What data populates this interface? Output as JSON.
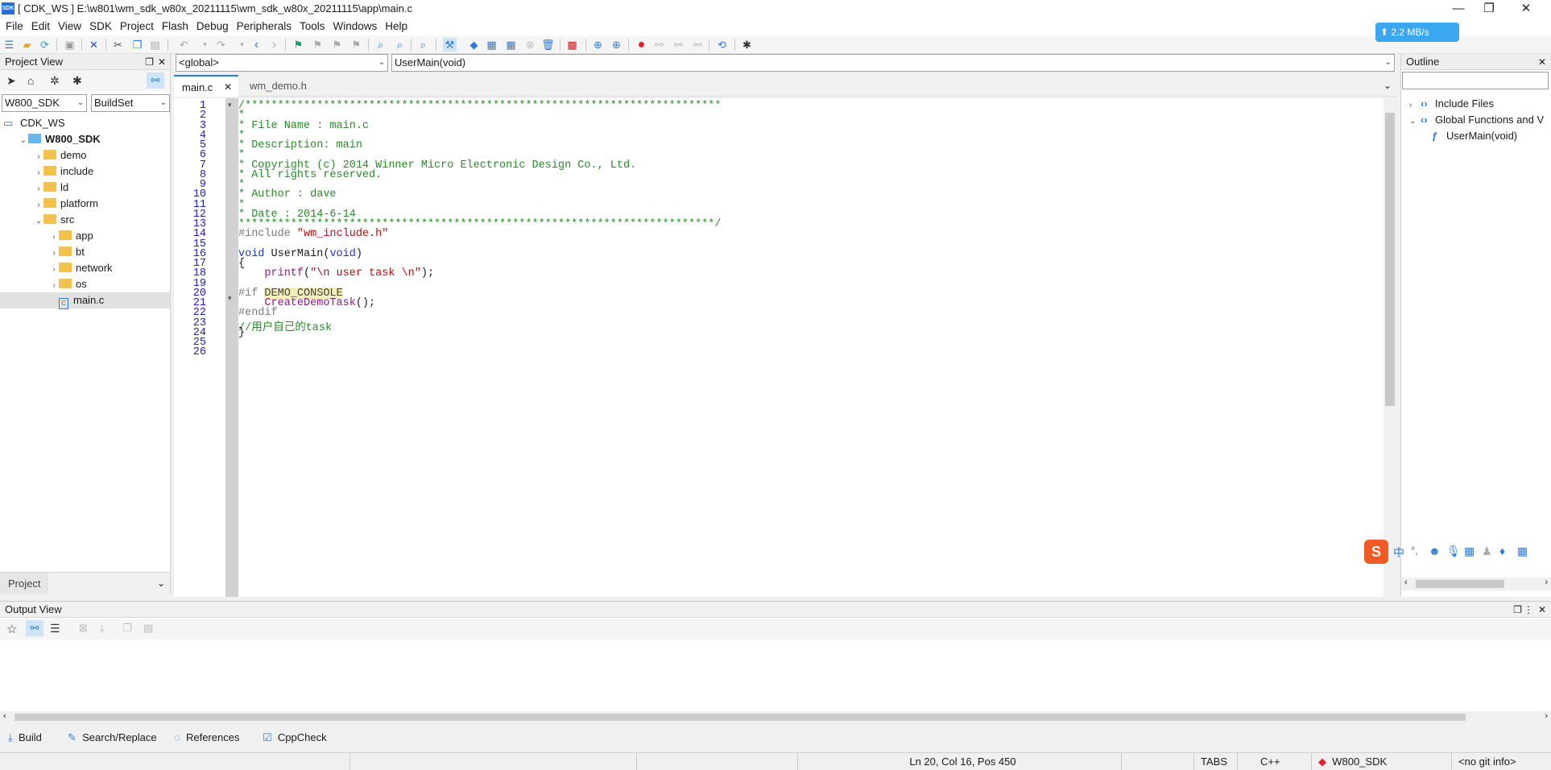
{
  "window": {
    "logo": "SDK",
    "title": "[ CDK_WS ] E:\\w801\\wm_sdk_w80x_20211115\\wm_sdk_w80x_20211115\\app\\main.c",
    "minimize": "—",
    "maximize": "❐",
    "close": "✕"
  },
  "menu": [
    "File",
    "Edit",
    "View",
    "SDK",
    "Project",
    "Flash",
    "Debug",
    "Peripherals",
    "Tools",
    "Windows",
    "Help"
  ],
  "network_speed": "⬆ 2.2 MB/s",
  "project_view": {
    "title": "Project View",
    "project_combo": "W800_SDK",
    "buildset_combo": "BuildSet",
    "tree": [
      {
        "label": "CDK_WS",
        "indent": 0,
        "kind": "workspace",
        "chev": ""
      },
      {
        "label": "W800_SDK",
        "indent": 1,
        "kind": "project",
        "chev": "⌄"
      },
      {
        "label": "demo",
        "indent": 2,
        "kind": "folder",
        "chev": "›"
      },
      {
        "label": "include",
        "indent": 2,
        "kind": "folder",
        "chev": "›"
      },
      {
        "label": "ld",
        "indent": 2,
        "kind": "folder",
        "chev": "›"
      },
      {
        "label": "platform",
        "indent": 2,
        "kind": "folder",
        "chev": "›"
      },
      {
        "label": "src",
        "indent": 2,
        "kind": "folder",
        "chev": "⌄"
      },
      {
        "label": "app",
        "indent": 3,
        "kind": "folder",
        "chev": "›"
      },
      {
        "label": "bt",
        "indent": 3,
        "kind": "folder",
        "chev": "›"
      },
      {
        "label": "network",
        "indent": 3,
        "kind": "folder",
        "chev": "›"
      },
      {
        "label": "os",
        "indent": 3,
        "kind": "folder",
        "chev": "›"
      },
      {
        "label": "main.c",
        "indent": 3,
        "kind": "file",
        "chev": "",
        "selected": true
      }
    ],
    "bottom_tab": "Project"
  },
  "editor": {
    "scope_combo": "<global>",
    "function_combo": "UserMain(void)",
    "tabs": [
      {
        "label": "main.c",
        "active": true,
        "close": "✕"
      },
      {
        "label": "wm_demo.h",
        "active": false
      }
    ],
    "lines": [
      {
        "n": "1",
        "t": "/*************************************************************************",
        "c": "comment"
      },
      {
        "n": "2",
        "t": "*",
        "c": "comment"
      },
      {
        "n": "3",
        "t": "* File Name : main.c",
        "c": "comment"
      },
      {
        "n": "4",
        "t": "*",
        "c": "comment"
      },
      {
        "n": "5",
        "t": "* Description: main",
        "c": "comment"
      },
      {
        "n": "6",
        "t": "*",
        "c": "comment"
      },
      {
        "n": "7",
        "t": "* Copyright (c) 2014 Winner Micro Electronic Design Co., Ltd.",
        "c": "comment"
      },
      {
        "n": "8",
        "t": "* All rights reserved.",
        "c": "comment"
      },
      {
        "n": "9",
        "t": "*",
        "c": "comment"
      },
      {
        "n": "10",
        "t": "* Author : dave",
        "c": "comment"
      },
      {
        "n": "11",
        "t": "*",
        "c": "comment"
      },
      {
        "n": "12",
        "t": "* Date : 2014-6-14",
        "c": "comment"
      },
      {
        "n": "13",
        "t": "*************************************************************************/",
        "c": "comment"
      },
      {
        "n": "14",
        "t": "",
        "c": "include"
      },
      {
        "n": "15",
        "t": "",
        "c": "plain"
      },
      {
        "n": "16",
        "t": "",
        "c": "func"
      },
      {
        "n": "17",
        "t": "{",
        "c": "plain"
      },
      {
        "n": "18",
        "t": "",
        "c": "printf"
      },
      {
        "n": "19",
        "t": "",
        "c": "plain"
      },
      {
        "n": "20",
        "t": "",
        "c": "ifdef"
      },
      {
        "n": "21",
        "t": "",
        "c": "call"
      },
      {
        "n": "22",
        "t": "#endif",
        "c": "pre"
      },
      {
        "n": "23",
        "t": "//用户自己的task",
        "c": "comment"
      },
      {
        "n": "24",
        "t": "}",
        "c": "plain"
      },
      {
        "n": "25",
        "t": "",
        "c": "plain"
      },
      {
        "n": "26",
        "t": "",
        "c": "plain"
      }
    ],
    "tokens": {
      "include_kw": "#include",
      "include_str": "\"wm_include.h\"",
      "void1": "void",
      "usermain": "UserMain",
      "void2": "void",
      "printf": "printf",
      "printf_args": "\"\\n user task \\n\"",
      "if_kw": "#if",
      "demo_console": "DEMO_CONSOLE",
      "create_task": "CreateDemoTask"
    }
  },
  "outline": {
    "title": "Outline",
    "items": [
      {
        "label": "Include Files",
        "indent": 0
      },
      {
        "label": "Global Functions and V",
        "indent": 0
      },
      {
        "label": "UserMain(void)",
        "indent": 1
      }
    ]
  },
  "output_view": {
    "title": "Output View",
    "tabs": [
      "Build",
      "Search/Replace",
      "References",
      "CppCheck"
    ]
  },
  "status": {
    "position": "Ln 20, Col 16, Pos 450",
    "tabs_mode": "TABS",
    "language": "C++",
    "project": "W800_SDK",
    "git": "<no git info>"
  },
  "ime": {
    "label": "中"
  }
}
